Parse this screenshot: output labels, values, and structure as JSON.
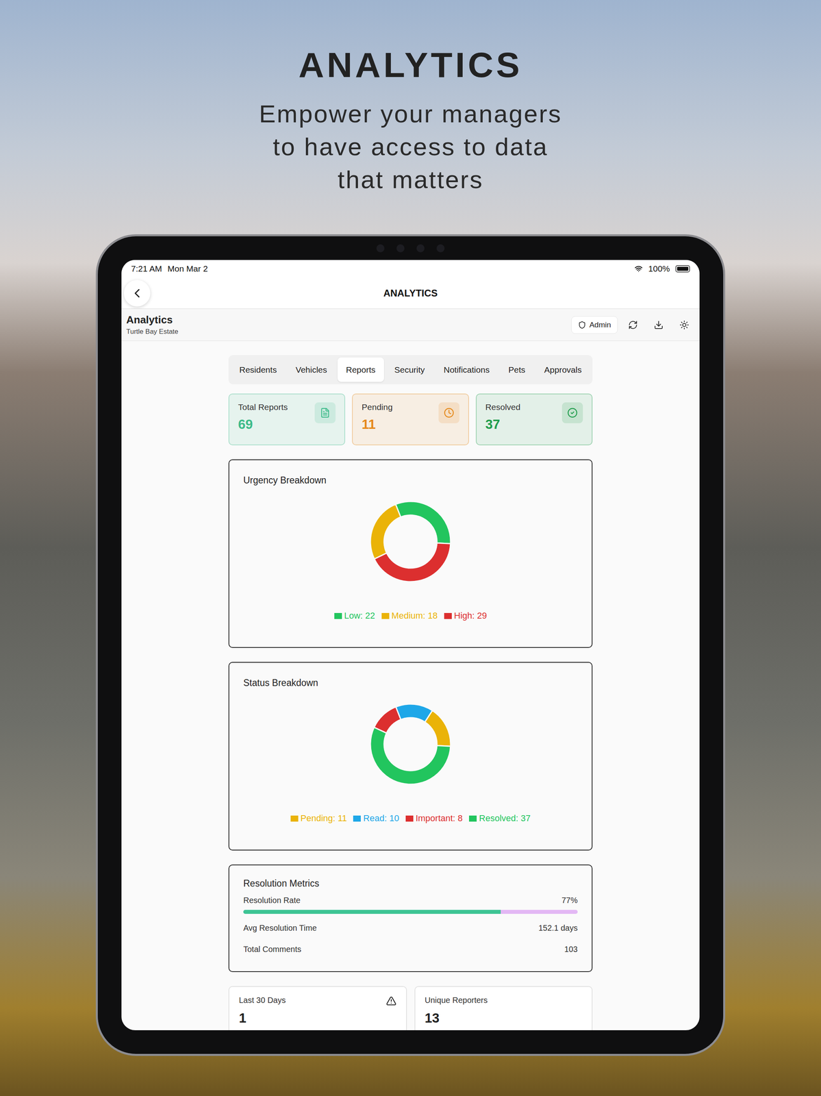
{
  "headline": {
    "title": "ANALYTICS",
    "lines": [
      "Empower your managers",
      "to have access to data",
      "that matters"
    ]
  },
  "status_bar": {
    "time": "7:21 AM",
    "date": "Mon Mar 2",
    "battery": "100%",
    "battery_level": 1
  },
  "nav": {
    "title": "ANALYTICS"
  },
  "header": {
    "title": "Analytics",
    "subtitle": "Turtle Bay Estate",
    "role": "Admin"
  },
  "tabs": [
    {
      "label": "Residents",
      "selected": false
    },
    {
      "label": "Vehicles",
      "selected": false
    },
    {
      "label": "Reports",
      "selected": true
    },
    {
      "label": "Security",
      "selected": false
    },
    {
      "label": "Notifications",
      "selected": false
    },
    {
      "label": "Pets",
      "selected": false
    },
    {
      "label": "Approvals",
      "selected": false
    }
  ],
  "stats": [
    {
      "label": "Total Reports",
      "value": "69",
      "color": "#3dbb8a"
    },
    {
      "label": "Pending",
      "value": "11",
      "color": "#e5891a"
    },
    {
      "label": "Resolved",
      "value": "37",
      "color": "#1f9d4c"
    }
  ],
  "charts": [
    {
      "title": "Urgency Breakdown",
      "series": [
        {
          "label": "Low",
          "value": 22,
          "legend": "Low: 22",
          "color": "#22c55e"
        },
        {
          "label": "Medium",
          "value": 18,
          "legend": "Medium: 18",
          "color": "#eab308"
        },
        {
          "label": "High",
          "value": 29,
          "legend": "High: 29",
          "color": "#dc2f2f"
        }
      ]
    },
    {
      "title": "Status Breakdown",
      "series": [
        {
          "label": "Pending",
          "value": 11,
          "legend": "Pending: 11",
          "color": "#eab308"
        },
        {
          "label": "Read",
          "value": 10,
          "legend": "Read: 10",
          "color": "#1ea7e8"
        },
        {
          "label": "Important",
          "value": 8,
          "legend": "Important: 8",
          "color": "#dc2f2f"
        },
        {
          "label": "Resolved",
          "value": 37,
          "legend": "Resolved: 37",
          "color": "#22c55e"
        }
      ]
    }
  ],
  "resolution": {
    "title": "Resolution Metrics",
    "rate": {
      "label": "Resolution Rate",
      "reading": "77%",
      "level": 0.77
    },
    "rows": [
      {
        "label": "Avg Resolution Time",
        "value": "152.1 days"
      },
      {
        "label": "Total Comments",
        "value": "103"
      }
    ]
  },
  "summary": [
    {
      "label": "Last 30 Days",
      "value": "1",
      "kind": "alert"
    },
    {
      "label": "Unique Reporters",
      "value": "13",
      "kind": "plain"
    }
  ]
}
